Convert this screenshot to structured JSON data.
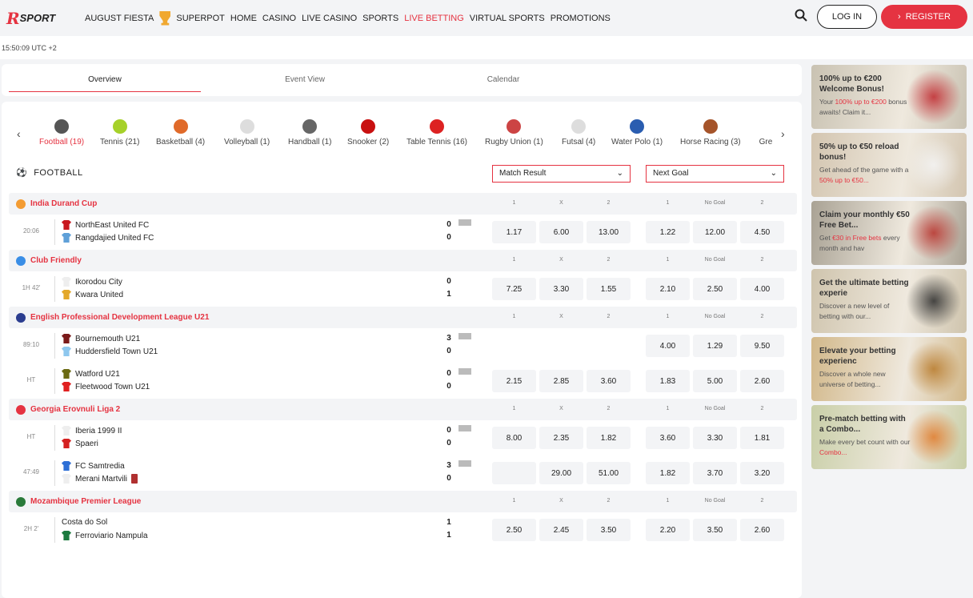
{
  "header": {
    "logo": "RS SPORT",
    "nav": [
      "AUGUST FIESTA",
      "SUPERPOT",
      "HOME",
      "CASINO",
      "LIVE CASINO",
      "SPORTS",
      "LIVE BETTING",
      "VIRTUAL SPORTS",
      "PROMOTIONS"
    ],
    "active_nav": "LIVE BETTING",
    "login": "LOG IN",
    "register": "REGISTER"
  },
  "time": "15:50:09 UTC +2",
  "tabs": [
    "Overview",
    "Event View",
    "Calendar"
  ],
  "sports": [
    {
      "label": "Football (19)",
      "color": "#555"
    },
    {
      "label": "Tennis (21)",
      "color": "#a6d12a"
    },
    {
      "label": "Basketball (4)",
      "color": "#e06a2a"
    },
    {
      "label": "Volleyball (1)",
      "color": "#ddd"
    },
    {
      "label": "Handball (1)",
      "color": "#666"
    },
    {
      "label": "Snooker (2)",
      "color": "#c81010"
    },
    {
      "label": "Table Tennis (16)",
      "color": "#d22"
    },
    {
      "label": "Rugby Union (1)",
      "color": "#c44"
    },
    {
      "label": "Futsal (4)",
      "color": "#ddd"
    },
    {
      "label": "Water Polo (1)",
      "color": "#2a5db0"
    },
    {
      "label": "Horse Racing (3)",
      "color": "#a5542a"
    },
    {
      "label": "Gre",
      "color": "#fff"
    }
  ],
  "section": {
    "title": "FOOTBALL",
    "market1": "Match Result",
    "market2": "Next Goal",
    "cols1": [
      "1",
      "X",
      "2"
    ],
    "cols2": [
      "1",
      "No Goal",
      "2"
    ]
  },
  "leagues": [
    {
      "name": "India Durand Cup",
      "flag": "#f39c33",
      "matches": [
        {
          "clock": "20:06",
          "home": "NorthEast United FC",
          "away": "Rangdajied United FC",
          "hs": "0",
          "as": "0",
          "hc": "#c8171e",
          "ac": "#5fa0d8",
          "pitch": true,
          "odds": [
            "1.17",
            "6.00",
            "13.00",
            "1.22",
            "12.00",
            "4.50"
          ]
        }
      ]
    },
    {
      "name": "Club Friendly",
      "flag": "#3a8ee6",
      "matches": [
        {
          "clock": "1H 42'",
          "home": "Ikorodou City",
          "away": "Kwara United",
          "hs": "0",
          "as": "1",
          "hc": "#eee",
          "ac": "#e3a82a",
          "pitch": false,
          "odds": [
            "7.25",
            "3.30",
            "1.55",
            "2.10",
            "2.50",
            "4.00"
          ]
        }
      ]
    },
    {
      "name": "English Professional Development League U21",
      "flag": "#2b3d8f",
      "matches": [
        {
          "clock": "89:10",
          "home": "Bournemouth U21",
          "away": "Huddersfield Town U21",
          "hs": "3",
          "as": "0",
          "hc": "#7a1a1a",
          "ac": "#8ec7ee",
          "pitch": true,
          "odds": [
            null,
            null,
            null,
            "4.00",
            "1.29",
            "9.50"
          ],
          "hide1": true
        },
        {
          "clock": "HT",
          "home": "Watford U21",
          "away": "Fleetwood Town U21",
          "hs": "0",
          "as": "0",
          "hc": "#6b6a12",
          "ac": "#e02020",
          "pitch": true,
          "odds": [
            "2.15",
            "2.85",
            "3.60",
            "1.83",
            "5.00",
            "2.60"
          ]
        }
      ]
    },
    {
      "name": "Georgia Erovnuli Liga 2",
      "flag": "#e53341",
      "matches": [
        {
          "clock": "HT",
          "home": "Iberia 1999 II",
          "away": "Spaeri",
          "hs": "0",
          "as": "0",
          "hc": "#eee",
          "ac": "#d42020",
          "pitch": true,
          "odds": [
            "8.00",
            "2.35",
            "1.82",
            "3.60",
            "3.30",
            "1.81"
          ]
        },
        {
          "clock": "47:49",
          "home": "FC Samtredia",
          "away": "Merani Martvili",
          "hs": "3",
          "as": "0",
          "hc": "#2d6fd6",
          "ac": "#eee",
          "pitch": true,
          "redcard": true,
          "odds": [
            "",
            "29.00",
            "51.00",
            "1.82",
            "3.70",
            "3.20"
          ]
        }
      ]
    },
    {
      "name": "Mozambique Premier League",
      "flag": "#2a7a3a",
      "matches": [
        {
          "clock": "2H 2'",
          "home": "Costa do Sol",
          "away": "Ferroviario Nampula",
          "hs": "1",
          "as": "1",
          "hc": null,
          "ac": "#1b7a3e",
          "pitch": false,
          "odds": [
            "2.50",
            "2.45",
            "3.50",
            "2.20",
            "3.50",
            "2.60"
          ]
        }
      ]
    }
  ],
  "promos": [
    {
      "title": "100% up to €200 Welcome Bonus!",
      "pre": "Your ",
      "hl": "100% up to €200",
      "post": " bonus awaits! Claim it...",
      "bg": "#c9c2b2",
      "art": "#c0262c"
    },
    {
      "title": "50% up to €50 reload bonus!",
      "pre": "Get ahead of the game with a ",
      "hl": "50% up to €50...",
      "post": "",
      "bg": "#d3c5b0",
      "art": "#f4f4f4"
    },
    {
      "title": "Claim your monthly €50 Free Bet...",
      "pre": "Get ",
      "hl": "€30 in Free bets",
      "post": " every month and hav",
      "bg": "#a9a294",
      "art": "#b8302a"
    },
    {
      "title": "Get the ultimate betting experie",
      "pre": "Discover a new level of betting with our...",
      "hl": "",
      "post": "",
      "bg": "#cfc4ad",
      "art": "#2a2a2a"
    },
    {
      "title": "Elevate your betting experienc",
      "pre": "Discover a whole new universe of betting...",
      "hl": "",
      "post": "",
      "bg": "#d2b88a",
      "art": "#b87a2a"
    },
    {
      "title": "Pre-match betting with a Combo...",
      "pre": "Make every bet count with our ",
      "hl": "Combo...",
      "post": "",
      "bg": "#c9cfa8",
      "art": "#e07a2a"
    }
  ]
}
